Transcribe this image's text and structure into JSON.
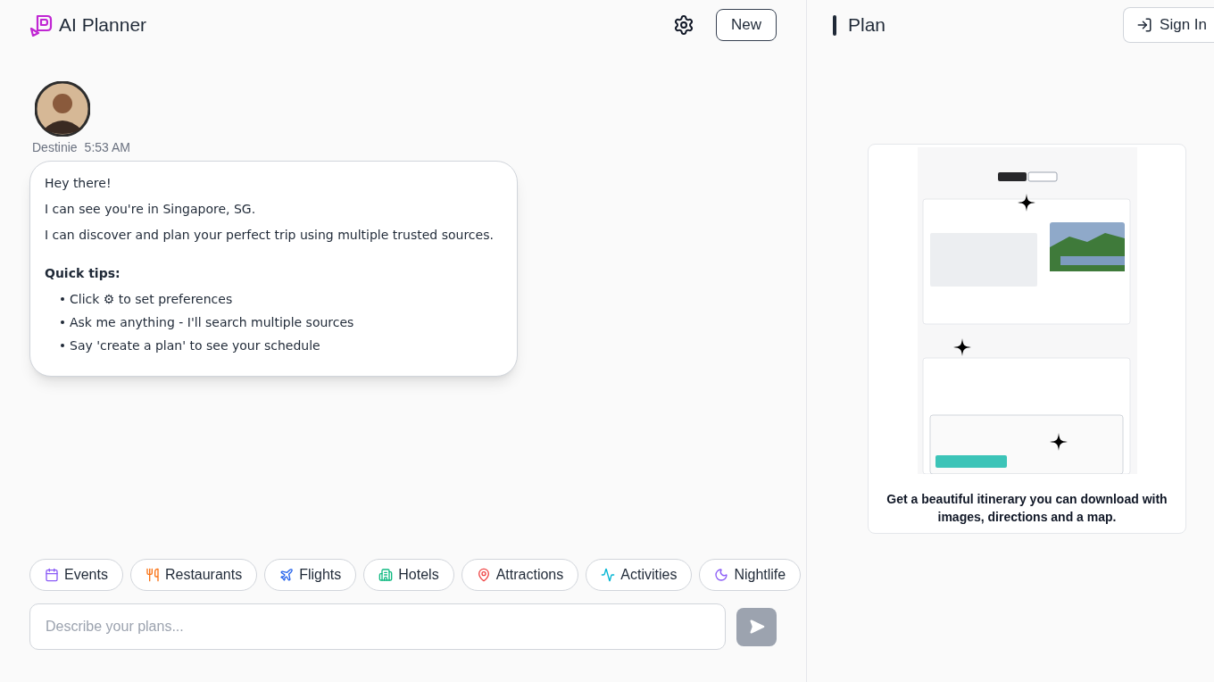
{
  "app": {
    "title": "AI Planner"
  },
  "header": {
    "new_button": "New"
  },
  "message": {
    "author": "Destinie",
    "time": "5:53 AM",
    "lines": [
      "Hey there!",
      "I can see you're in Singapore, SG.",
      "I can discover and plan your perfect trip using multiple trusted sources."
    ],
    "tips_title": "Quick tips:",
    "tips": [
      "Click ⚙ to set preferences",
      "Ask me anything - I'll search multiple sources",
      "Say 'create a plan' to see your schedule"
    ]
  },
  "chips": [
    {
      "label": "Events",
      "kind": "events"
    },
    {
      "label": "Restaurants",
      "kind": "restaurants"
    },
    {
      "label": "Flights",
      "kind": "flights"
    },
    {
      "label": "Hotels",
      "kind": "hotels"
    },
    {
      "label": "Attractions",
      "kind": "attractions"
    },
    {
      "label": "Activities",
      "kind": "activities"
    },
    {
      "label": "Nightlife",
      "kind": "nightlife"
    }
  ],
  "composer": {
    "placeholder": "Describe your plans...",
    "send_disabled": true
  },
  "plan": {
    "title": "Plan",
    "sign_in": "Sign In",
    "caption": "Get a beautiful itinerary you can download with images, directions and a map."
  }
}
